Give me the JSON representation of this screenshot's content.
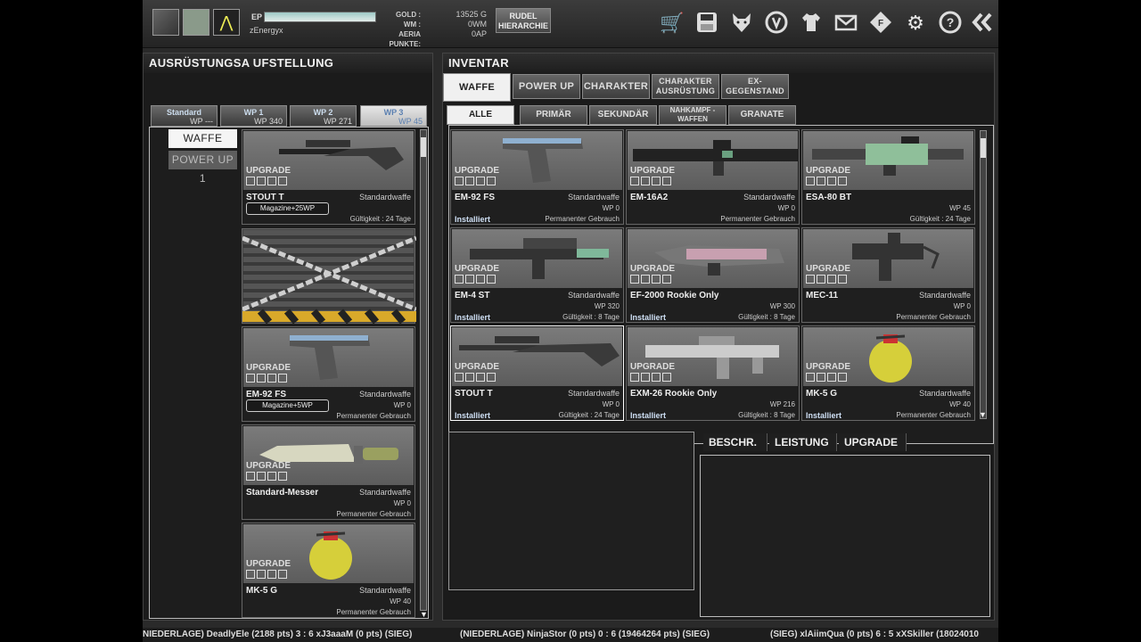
{
  "topbar": {
    "ep_label": "EP",
    "player_name": "zEnergyx",
    "currency_labels": [
      "GOLD :",
      "WM :",
      "AERIA PUNKTE:"
    ],
    "currency_values": [
      "13525 G",
      "0WM",
      "0AP"
    ],
    "rudel_button": "RUDEL\nHIERARCHIE",
    "tool_icons": [
      "cart-icon",
      "save-icon",
      "wolf-icon",
      "emblem-icon",
      "shirt-icon",
      "mail-icon",
      "coupon-icon",
      "gear-icon",
      "help-icon",
      "back-icon"
    ]
  },
  "left_panel": {
    "title": "AUSRÜSTUNGSA UFSTELLUNG",
    "wp_tabs": [
      {
        "title": "Standard",
        "sub": "WP ---"
      },
      {
        "title": "WP 1",
        "sub": "WP 340"
      },
      {
        "title": "WP 2",
        "sub": "WP 271"
      },
      {
        "title": "WP 3",
        "sub": "WP 45"
      }
    ],
    "buttons": {
      "waffe": "WAFFE",
      "powerup": "POWER UP 1"
    },
    "items": [
      {
        "upgrade": "UPGRADE",
        "name": "STOUT T",
        "type": "Standardwaffe",
        "wp": "",
        "valid": "Gültigkeit : 24 Tage",
        "mag": "Magazine+25WP"
      },
      {
        "locked": true
      },
      {
        "upgrade": "UPGRADE",
        "name": "EM-92 FS",
        "type": "Standardwaffe",
        "wp": "WP 0",
        "valid": "Permanenter Gebrauch",
        "mag": "Magazine+5WP"
      },
      {
        "upgrade": "UPGRADE",
        "name": "Standard-Messer",
        "type": "Standardwaffe",
        "wp": "WP 0",
        "valid": "Permanenter Gebrauch"
      },
      {
        "upgrade": "UPGRADE",
        "name": "MK-5 G",
        "type": "Standardwaffe",
        "wp": "WP 40",
        "valid": "Permanenter Gebrauch"
      }
    ]
  },
  "right_panel": {
    "title": "INVENTAR",
    "category_tabs": [
      "WAFFE",
      "POWER UP",
      "CHARAKTER",
      "CHARAKTER AUSRÜSTUNG",
      "EX-GEGENSTAND"
    ],
    "filter_tabs": [
      "ALLE",
      "PRIMÄR",
      "SEKUNDÄR",
      "NAHKAMPF -WAFFEN",
      "GRANATE"
    ],
    "items": [
      {
        "upgrade": "UPGRADE",
        "name": "EM-92 FS",
        "type": "Standardwaffe",
        "wp": "WP 0",
        "status": "Installiert",
        "valid": "Permanenter Gebrauch"
      },
      {
        "upgrade": "UPGRADE",
        "name": "EM-16A2",
        "type": "Standardwaffe",
        "wp": "WP 0",
        "status": "",
        "valid": "Permanenter Gebrauch"
      },
      {
        "upgrade": "UPGRADE",
        "name": "ESA-80 BT",
        "type": "",
        "wp": "WP 45",
        "status": "",
        "valid": "Gültigkeit : 24 Tage"
      },
      {
        "upgrade": "UPGRADE",
        "name": "EM-4 ST",
        "type": "Standardwaffe",
        "wp": "WP 320",
        "status": "Installiert",
        "valid": "Gültigkeit : 8 Tage"
      },
      {
        "upgrade": "UPGRADE",
        "name": "EF-2000 Rookie Only",
        "type": "",
        "wp": "WP 300",
        "status": "Installiert",
        "valid": "Gültigkeit : 8 Tage"
      },
      {
        "upgrade": "UPGRADE",
        "name": "MEC-11",
        "type": "Standardwaffe",
        "wp": "WP 0",
        "status": "",
        "valid": "Permanenter Gebrauch"
      },
      {
        "upgrade": "UPGRADE",
        "name": "STOUT T",
        "type": "Standardwaffe",
        "wp": "WP 0",
        "status": "Installiert",
        "valid": "Gültigkeit : 24 Tage"
      },
      {
        "upgrade": "UPGRADE",
        "name": "EXM-26 Rookie Only",
        "type": "",
        "wp": "WP 216",
        "status": "Installiert",
        "valid": "Gültigkeit : 8 Tage"
      },
      {
        "upgrade": "UPGRADE",
        "name": "MK-5 G",
        "type": "Standardwaffe",
        "wp": "WP 40",
        "status": "Installiert",
        "valid": "Permanenter Gebrauch"
      }
    ],
    "detail_tabs": [
      "BESCHR.",
      "LEISTUNG",
      "UPGRADE"
    ]
  },
  "ticker": [
    "NIEDERLAGE) DeadlyEle (2188 pts) 3 : 6 xJ3aaaM (0 pts) (SIEG)",
    "(NIEDERLAGE) NinjaStor (0 pts) 0 : 6 (19464264 pts) (SIEG)",
    "(SIEG) xlAiimQua (0 pts) 6 : 5 xXSkiller (18024010"
  ]
}
